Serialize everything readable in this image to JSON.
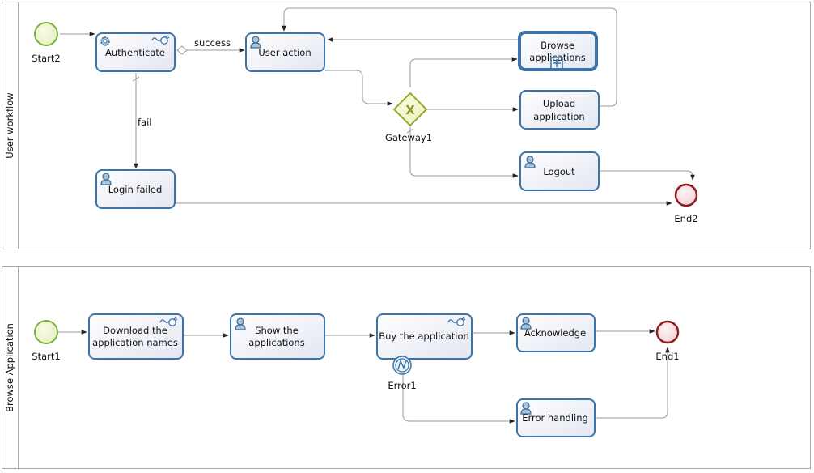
{
  "pools": [
    {
      "label": "User workflow",
      "elements": {
        "start": "Start2",
        "authenticate": "Authenticate",
        "user_action": "User action",
        "browse": "Browse applications",
        "browse_l1": "Browse",
        "browse_l2": "applications",
        "upload_l1": "Upload",
        "upload_l2": "application",
        "logout": "Logout",
        "login_failed": "Login failed",
        "gateway": "Gateway1",
        "end": "End2"
      },
      "flows": {
        "success": "success",
        "fail": "fail"
      }
    },
    {
      "label": "Browse Application",
      "elements": {
        "start": "Start1",
        "download_l1": "Download the",
        "download_l2": "application names",
        "show_l1": "Show the",
        "show_l2": "applications",
        "buy": "Buy the application",
        "error_event": "Error1",
        "acknowledge": "Acknowledge",
        "error_handling": "Error handling",
        "end": "End1"
      }
    }
  ],
  "icons": {
    "service_task": "gear-icon",
    "connector": "plug-icon",
    "user_task": "user-icon",
    "subprocess": "plus-box-icon",
    "error": "lightning-icon",
    "gateway_type": "x-exclusive-icon"
  },
  "colors": {
    "task_stroke": "#3a74aa",
    "start_stroke": "#76b043",
    "end_stroke": "#8e1c20",
    "gateway_stroke": "#98a82e",
    "flow_line": "#9a9a9a"
  }
}
